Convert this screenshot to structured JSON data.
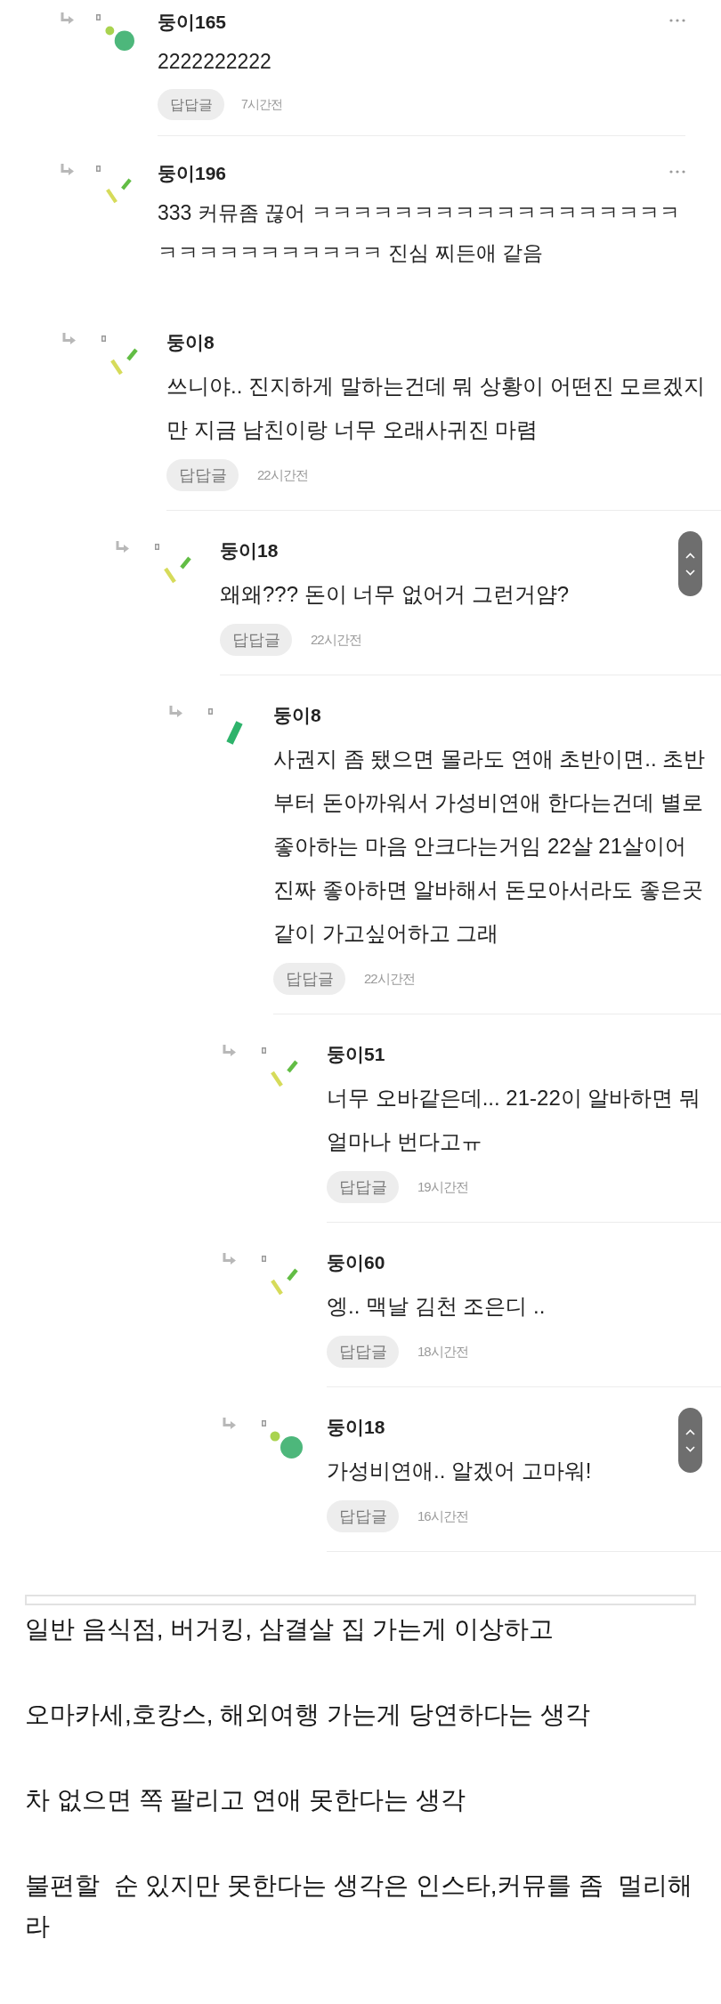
{
  "comment_threads": [
    {
      "comments": [
        {
          "author": "둥이165",
          "avatar": {
            "kind": "dots"
          },
          "lines": [
            "2222222222"
          ],
          "tag": "답답글",
          "time": "7시간전",
          "scroll_buttons": false
        },
        {
          "author": "둥이196",
          "avatar": {
            "kind": "slashes"
          },
          "lines": [
            "333 커뮤좀 끊어 ㅋㅋㅋㅋㅋㅋㅋㅋㅋㅋㅋㅋㅋㅋㅋㅋㅋㅋ",
            "ㅋㅋㅋㅋㅋㅋㅋㅋㅋㅋㅋ 진심 찌든애 같음"
          ],
          "scroll_buttons": false
        }
      ]
    },
    {
      "comments": [
        {
          "author": "둥이8",
          "avatar": {
            "kind": "slashes"
          },
          "lines": [
            "쓰니야.. 진지하게 말하는건데 뭐 상황이 어떤진 모르겠지",
            "만 지금 남친이랑 너무 오래사귀진 마렴"
          ],
          "tag": "답답글",
          "time": "22시간전",
          "scroll_buttons": false,
          "children": [
            {
              "author": "둥이18",
              "avatar": {
                "kind": "slashes"
              },
              "lines": [
                "왜왜??? 돈이 너무 없어거 그런거얌?"
              ],
              "tag": "답답글",
              "time": "22시간전",
              "scroll_buttons": true,
              "children": [
                {
                  "author": "둥이8",
                  "avatar": {
                    "kind": "bar"
                  },
                  "lines": [
                    "사권지 좀 됐으면 몰라도 연애 초반이면.. 초반",
                    "부터 돈아까워서 가성비연애 한다는건데 별로",
                    "좋아하는 마음 안크다는거임 22살 21살이어",
                    "진짜 좋아하면 알바해서 돈모아서라도 좋은곳",
                    "같이 가고싶어하고 그래"
                  ],
                  "tag": "답답글",
                  "time": "22시간전",
                  "scroll_buttons": false,
                  "children": [
                    {
                      "author": "둥이51",
                      "avatar": {
                        "kind": "slashes"
                      },
                      "lines": [
                        "너무 오바같은데... 21-22이 알바하면 뭐",
                        "얼마나 번다고ㅠ"
                      ],
                      "tag": "답답글",
                      "time": "19시간전",
                      "scroll_buttons": false
                    },
                    {
                      "author": "둥이60",
                      "avatar": {
                        "kind": "slashes"
                      },
                      "lines": [
                        "엥.. 맥날 김천 조은디 .."
                      ],
                      "tag": "답답글",
                      "time": "18시간전",
                      "scroll_buttons": false
                    },
                    {
                      "author": "둥이18",
                      "avatar": {
                        "kind": "dots"
                      },
                      "lines": [
                        "가성비연애.. 알겠어 고마워!"
                      ],
                      "tag": "답답글",
                      "time": "16시간전",
                      "scroll_buttons": true
                    }
                  ]
                }
              ]
            }
          ]
        }
      ]
    }
  ],
  "post_body": {
    "paragraphs": [
      "일반 음식점, 버거킹, 삼결살 집 가는게 이상하고",
      "오마카세,호캉스, 해외여행 가는게 당연하다는 생각",
      "차 없으면 쪽 팔리고 연애 못한다는 생각",
      "불편할  순 있지만 못한다는 생각은 인스타,커뮤를 좀  멀리해라"
    ]
  }
}
